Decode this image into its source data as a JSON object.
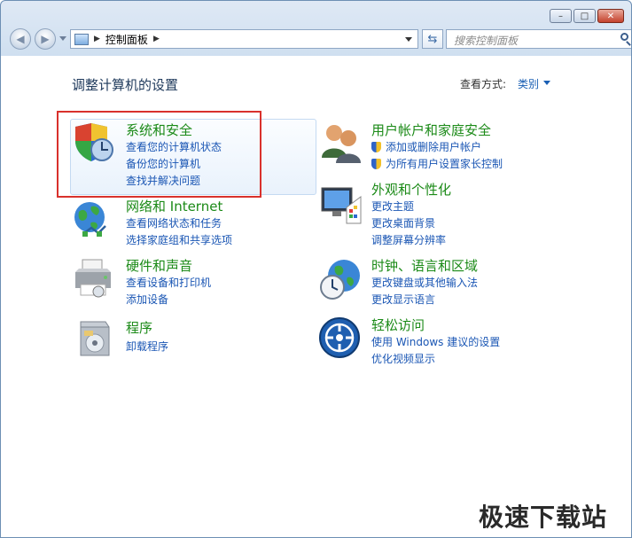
{
  "window": {
    "caption_buttons": [
      "minimize",
      "maximize",
      "close"
    ]
  },
  "nav": {
    "back_icon": "back-arrow-icon",
    "forward_icon": "forward-arrow-icon",
    "address": {
      "breadcrumb": "控制面板"
    },
    "search": {
      "placeholder": "搜索控制面板"
    }
  },
  "main": {
    "title": "调整计算机的设置",
    "view_by": {
      "label": "查看方式:",
      "value": "类别"
    },
    "categories": [
      {
        "title": "系统和安全",
        "icon": "shield-clock-icon",
        "links": [
          "查看您的计算机状态",
          "备份您的计算机",
          "查找并解决问题"
        ]
      },
      {
        "title": "网络和 Internet",
        "icon": "globe-network-icon",
        "links": [
          "查看网络状态和任务",
          "选择家庭组和共享选项"
        ]
      },
      {
        "title": "硬件和声音",
        "icon": "printer-icon",
        "links": [
          "查看设备和打印机",
          "添加设备"
        ]
      },
      {
        "title": "程序",
        "icon": "programs-box-icon",
        "links": [
          "卸载程序"
        ]
      },
      {
        "title": "用户帐户和家庭安全",
        "icon": "users-icon",
        "links": [
          "添加或删除用户帐户",
          "为所有用户设置家长控制"
        ]
      },
      {
        "title": "外观和个性化",
        "icon": "monitor-palette-icon",
        "links": [
          "更改主题",
          "更改桌面背景",
          "调整屏幕分辨率"
        ]
      },
      {
        "title": "时钟、语言和区域",
        "icon": "globe-clock-icon",
        "links": [
          "更改键盘或其他输入法",
          "更改显示语言"
        ]
      },
      {
        "title": "轻松访问",
        "icon": "ease-of-access-icon",
        "links": [
          "使用 Windows 建议的设置",
          "优化视频显示"
        ]
      }
    ]
  },
  "watermark": "极速下载站",
  "colors": {
    "link": "#1a56b4",
    "category_title": "#1b8a17",
    "highlight_border": "#d9312c"
  }
}
